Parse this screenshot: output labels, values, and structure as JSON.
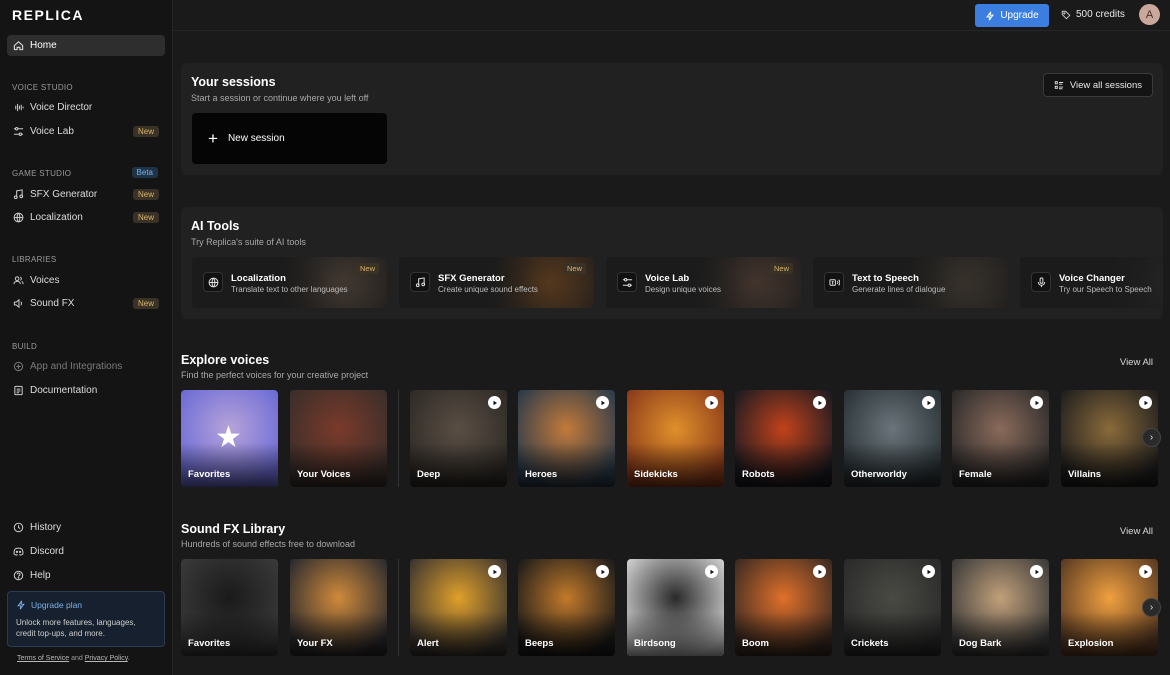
{
  "app": {
    "logo": "REPLICA"
  },
  "sidebar": {
    "home": "Home",
    "voice_studio_label": "VOICE STUDIO",
    "voice_director": "Voice Director",
    "voice_lab": "Voice Lab",
    "game_studio_label": "GAME STUDIO",
    "beta_badge": "Beta",
    "sfx_generator": "SFX Generator",
    "localization": "Localization",
    "libraries_label": "LIBRARIES",
    "voices": "Voices",
    "sound_fx": "Sound FX",
    "build_label": "BUILD",
    "apps_integrations": "App and Integrations",
    "documentation": "Documentation",
    "history": "History",
    "discord": "Discord",
    "help": "Help",
    "new_badge": "New",
    "upgrade_title": "Upgrade plan",
    "upgrade_desc": "Unlock more features, languages, credit top-ups, and more.",
    "legal_tos": "Terms of Service",
    "legal_and": "and",
    "legal_privacy": "Privacy Policy",
    "legal_dot": "."
  },
  "topbar": {
    "upgrade": "Upgrade",
    "credits": "500 credits",
    "avatar_initial": "A"
  },
  "sessions": {
    "title": "Your sessions",
    "subtitle": "Start a session or continue where you left off",
    "view_all": "View all sessions",
    "new_session": "New session"
  },
  "ai_tools": {
    "title": "AI Tools",
    "subtitle": "Try Replica's suite of AI tools",
    "cards": [
      {
        "name": "Localization",
        "desc": "Translate text to other languages",
        "new": "New",
        "color": "#5a4a3e"
      },
      {
        "name": "SFX Generator",
        "desc": "Create unique sound effects",
        "new": "New",
        "color": "#7a4a1e"
      },
      {
        "name": "Voice Lab",
        "desc": "Design unique voices",
        "new": "New",
        "color": "#5c4438"
      },
      {
        "name": "Text to Speech",
        "desc": "Generate lines of dialogue",
        "new": "",
        "color": "#4a4036"
      },
      {
        "name": "Voice Changer",
        "desc": "Try our Speech to Speech",
        "new": "",
        "color": "#2a2a2a"
      }
    ]
  },
  "explore_voices": {
    "title": "Explore voices",
    "subtitle": "Find the perfect voices for your creative project",
    "view_all": "View All",
    "tiles": [
      {
        "label": "Favorites",
        "colors": [
          "#6b6bd6",
          "#b7a3d9"
        ]
      },
      {
        "label": "Your Voices",
        "colors": [
          "#3a2e2a",
          "#7a3a2a"
        ]
      },
      {
        "label": "Deep",
        "colors": [
          "#2e2a26",
          "#5a4e44"
        ]
      },
      {
        "label": "Heroes",
        "colors": [
          "#2a3a4a",
          "#c27a3a"
        ]
      },
      {
        "label": "Sidekicks",
        "colors": [
          "#8a3a1a",
          "#e0902a"
        ]
      },
      {
        "label": "Robots",
        "colors": [
          "#1a1a22",
          "#c2421a"
        ]
      },
      {
        "label": "Otherworldy",
        "colors": [
          "#2a3236",
          "#6a747a"
        ]
      },
      {
        "label": "Female",
        "colors": [
          "#2a2a2a",
          "#8a6a5a"
        ]
      },
      {
        "label": "Villains",
        "colors": [
          "#1e1e1e",
          "#8a6a3a"
        ]
      }
    ]
  },
  "sound_fx": {
    "title": "Sound FX Library",
    "subtitle": "Hundreds of sound effects free to download",
    "view_all": "View All",
    "tiles": [
      {
        "label": "Favorites",
        "colors": [
          "#3a3a3a",
          "#1a1a1a"
        ]
      },
      {
        "label": "Your FX",
        "colors": [
          "#2a2a2e",
          "#d08a3a"
        ]
      },
      {
        "label": "Alert",
        "colors": [
          "#3a3430",
          "#e0a02a"
        ]
      },
      {
        "label": "Beeps",
        "colors": [
          "#1a1a1a",
          "#c27a2a"
        ]
      },
      {
        "label": "Birdsong",
        "colors": [
          "#cfcfcf",
          "#2a2a2a"
        ]
      },
      {
        "label": "Boom",
        "colors": [
          "#3a2a22",
          "#e0702a"
        ]
      },
      {
        "label": "Crickets",
        "colors": [
          "#2a2a2a",
          "#4a4a44"
        ]
      },
      {
        "label": "Dog Bark",
        "colors": [
          "#3a3a3a",
          "#c2a07a"
        ]
      },
      {
        "label": "Explosion",
        "colors": [
          "#5a3a22",
          "#f0a040"
        ]
      }
    ]
  }
}
